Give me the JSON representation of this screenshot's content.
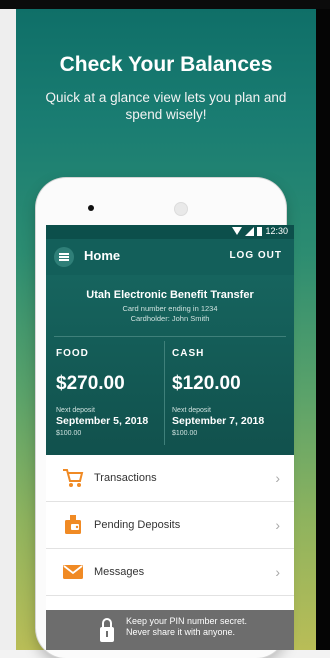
{
  "promo": {
    "headline": "Check Your Balances",
    "subline": "Quick at a glance view lets you plan and spend wisely!"
  },
  "status": {
    "time": "12:30"
  },
  "appbar": {
    "title": "Home",
    "logout": "LOG OUT"
  },
  "card": {
    "title": "Utah Electronic Benefit Transfer",
    "card_number": "Card number ending in 1234",
    "cardholder": "Cardholder: John Smith"
  },
  "balances": {
    "food": {
      "label": "FOOD",
      "amount": "$270.00",
      "next_label": "Next deposit",
      "next_date": "September 5, 2018",
      "next_amount": "$100.00"
    },
    "cash": {
      "label": "CASH",
      "amount": "$120.00",
      "next_label": "Next deposit",
      "next_date": "September 7, 2018",
      "next_amount": "$100.00"
    }
  },
  "menu": [
    {
      "label": "Transactions",
      "icon": "cart-icon"
    },
    {
      "label": "Pending Deposits",
      "icon": "deposit-icon"
    },
    {
      "label": "Messages",
      "icon": "envelope-icon"
    }
  ],
  "banner": {
    "line1": "Keep your PIN number secret.",
    "line2": "Never share it with anyone."
  },
  "colors": {
    "primary": "#135f5a",
    "accent": "#f08a24"
  }
}
